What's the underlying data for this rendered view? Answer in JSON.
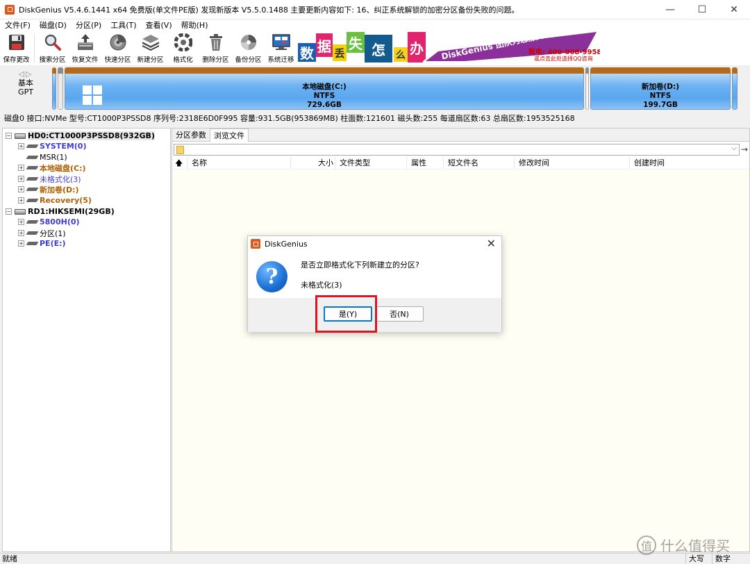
{
  "window": {
    "title": "DiskGenius V5.4.6.1441 x64 免费版(单文件PE版)  发现新版本 V5.5.0.1488  主要更新内容如下: 16、纠正系统解锁的加密分区备份失败的问题。",
    "minimize": "—",
    "maximize": "☐",
    "close": "✕"
  },
  "menu": [
    "文件(F)",
    "磁盘(D)",
    "分区(P)",
    "工具(T)",
    "查看(V)",
    "帮助(H)"
  ],
  "toolbar": [
    {
      "label": "保存更改",
      "icon": "save-icon"
    },
    {
      "label": "搜索分区",
      "icon": "search-partition-icon"
    },
    {
      "label": "恢复文件",
      "icon": "recover-file-icon"
    },
    {
      "label": "快速分区",
      "icon": "quick-partition-icon"
    },
    {
      "label": "新建分区",
      "icon": "new-partition-icon"
    },
    {
      "label": "格式化",
      "icon": "format-icon"
    },
    {
      "label": "删除分区",
      "icon": "delete-partition-icon"
    },
    {
      "label": "备份分区",
      "icon": "backup-partition-icon"
    },
    {
      "label": "系统迁移",
      "icon": "system-migrate-icon"
    }
  ],
  "banner": {
    "chars": [
      "数",
      "据",
      "丢",
      "失",
      "怎",
      "么",
      "办"
    ],
    "slogan": "DiskGenius 团队为您服务",
    "phone": "致电: 400-008-9958",
    "qq": "或点击此处选择QQ咨询"
  },
  "disk_nav": {
    "arrows": "◁▷",
    "type": "基本",
    "scheme": "GPT"
  },
  "partitions": [
    {
      "name": "本地磁盘(C:)",
      "fs": "NTFS",
      "size": "729.6GB"
    },
    {
      "name": "新加卷(D:)",
      "fs": "NTFS",
      "size": "199.7GB"
    }
  ],
  "disk_info": "磁盘0 接口:NVMe  型号:CT1000P3PSSD8  序列号:2318E6D0F995  容量:931.5GB(953869MB)  柱面数:121601  磁头数:255  每道扇区数:63  总扇区数:1953525168",
  "tree": {
    "disk0": "HD0:CT1000P3PSSD8(932GB)",
    "disk0_parts": [
      "SYSTEM(0)",
      "MSR(1)",
      "本地磁盘(C:)",
      "未格式化(3)",
      "新加卷(D:)",
      "Recovery(5)"
    ],
    "disk1": "RD1:HIKSEMI(29GB)",
    "disk1_parts": [
      "5800H(0)",
      "分区(1)",
      "PE(E:)"
    ]
  },
  "tabs": [
    "分区参数",
    "浏览文件"
  ],
  "path": {
    "dropdown": "⌵",
    "go": "→"
  },
  "columns": [
    "名称",
    "大小",
    "文件类型",
    "属性",
    "短文件名",
    "修改时间",
    "创建时间"
  ],
  "dialog": {
    "title": "DiskGenius",
    "close": "✕",
    "icon_glyph": "?",
    "question": "是否立即格式化下列新建立的分区?",
    "partition_name": "未格式化(3)",
    "yes": "是(Y)",
    "no": "否(N)"
  },
  "status": {
    "left": "就绪",
    "caps": "大写",
    "num": "数字"
  },
  "watermark": {
    "glyph": "值",
    "text": "什么值得买"
  },
  "colors": {
    "accent": "#0078d4",
    "highlight": "#e0141e",
    "partition_stripe": "#b46a1c",
    "partition_fill": "#5aa6ee"
  }
}
